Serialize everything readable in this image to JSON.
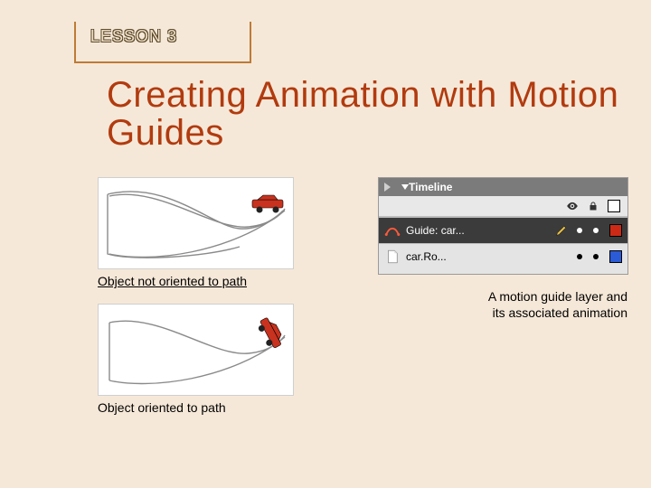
{
  "lesson_label": "LESSON 3",
  "title": "Creating Animation with Motion Guides",
  "caption_not_oriented": "Object not oriented to path",
  "caption_oriented": "Object oriented to path",
  "right_caption": "A motion guide layer and its associated animation",
  "timeline": {
    "title": "Timeline",
    "guide_layer": "Guide: car...",
    "anim_layer": "car.Ro..."
  }
}
